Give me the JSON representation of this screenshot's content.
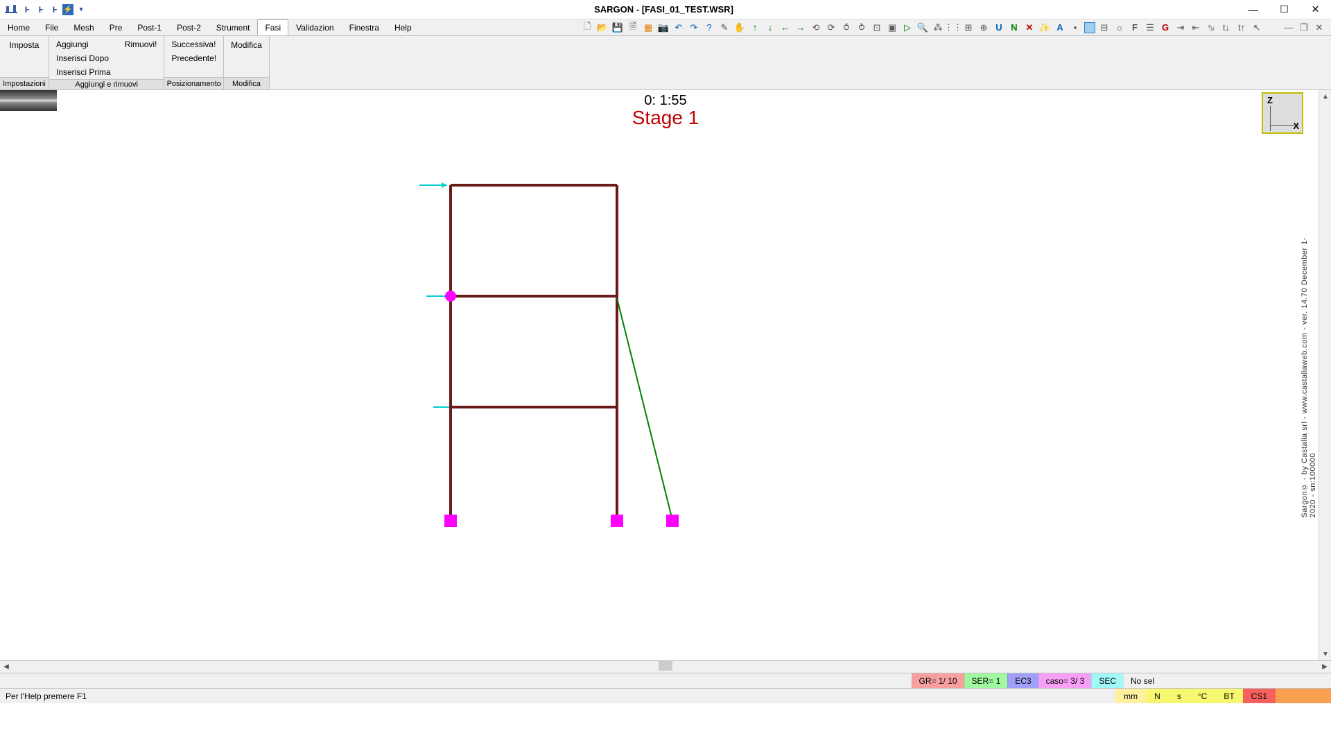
{
  "title": "SARGON - [FASI_01_TEST.WSR]",
  "menubar": [
    "Home",
    "File",
    "Mesh",
    "Pre",
    "Post-1",
    "Post-2",
    "Strument",
    "Fasi",
    "Validazion",
    "Finestra",
    "Help"
  ],
  "active_menu": 7,
  "ribbon": {
    "groups": [
      {
        "footer": "Impostazioni",
        "items": [
          {
            "label": "Imposta",
            "big": true
          }
        ]
      },
      {
        "footer": "Aggiungi e rimuovi",
        "items": [
          {
            "label": "Aggiungi"
          },
          {
            "label": "Rimuovi!"
          },
          {
            "label": "Inserisci Dopo"
          },
          {
            "label": "Inserisci Prima"
          }
        ],
        "cols": [
          [
            "Aggiungi",
            "Inserisci Dopo",
            "Inserisci Prima"
          ],
          [
            "Rimuovi!"
          ]
        ]
      },
      {
        "footer": "Posizionamento",
        "items": [],
        "cols": [
          [
            "Successiva!",
            "Precedente!"
          ]
        ]
      },
      {
        "footer": "Modifica",
        "items": [
          {
            "label": "Modifica",
            "big": true
          }
        ]
      }
    ]
  },
  "canvas": {
    "time": "0: 1:55",
    "stage": "Stage 1",
    "axis_z": "Z",
    "axis_x": "X",
    "side_text": "Sargon© - by Castalia srl - www.castaliaweb.com - ver. 14.70 December 1-2020 - sn:100000"
  },
  "status1": {
    "gr": "GR=   1/ 10",
    "ser": "SER= 1",
    "ec3": "EC3",
    "caso": "caso=    3/   3",
    "sec": "SEC",
    "nosel": "No sel"
  },
  "status2": {
    "help": "Per l'Help premere F1",
    "mm": "mm",
    "n": "N",
    "s": "s",
    "c": "°C",
    "bt": "BT",
    "cs1": "CS1"
  }
}
